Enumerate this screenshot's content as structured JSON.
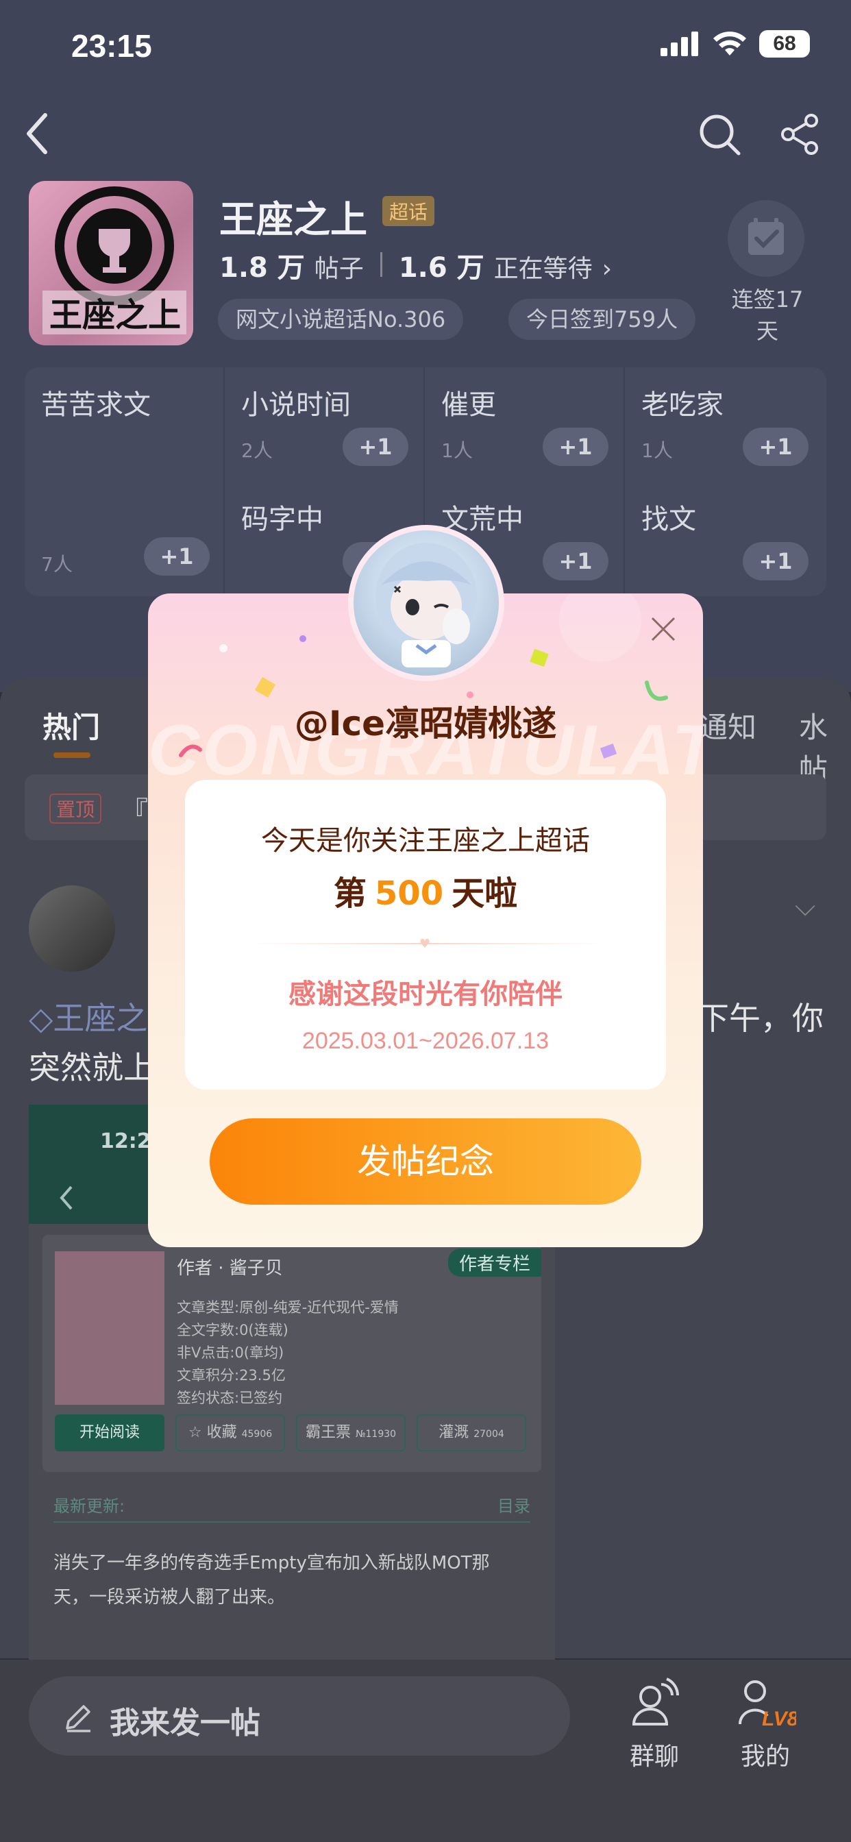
{
  "status_bar": {
    "time": "23:15",
    "battery": "68"
  },
  "topic": {
    "title": "王座之上",
    "badge": "超话",
    "posts_count": "1.8 万",
    "posts_label": "帖子",
    "waiting_count": "1.6 万",
    "waiting_label": "正在等待",
    "rank_tag": "网文小说超话No.306",
    "checkin_tag": "今日签到759人",
    "streak_line1": "连签17",
    "streak_line2": "天"
  },
  "groups": [
    {
      "name": "苦苦求文",
      "count": "7人",
      "plus": "+1"
    },
    {
      "name": "小说时间",
      "count": "2人",
      "plus": "+1"
    },
    {
      "name": "催更",
      "count": "1人",
      "plus": "+1"
    },
    {
      "name": "老吃家",
      "count": "1人",
      "plus": "+1"
    },
    {
      "name": "码字中",
      "count": "",
      "plus": "+1"
    },
    {
      "name": "文荒中",
      "count": "",
      "plus": "+1"
    },
    {
      "name": "找文",
      "count": "",
      "plus": "+1"
    }
  ],
  "tabs": {
    "hot": "热门",
    "notice": "通知",
    "water": "水帖"
  },
  "pinned": {
    "badge": "置顶",
    "text": "『超"
  },
  "post": {
    "topic_link": "王座之",
    "text_line1_end": "下午，你",
    "text_line2": "突然就上"
  },
  "book": {
    "time": "12:27",
    "author": "作者 · 酱子贝",
    "column_btn": "作者专栏",
    "meta": [
      "文章类型:原创-纯爱-近代现代-爱情",
      "全文字数:0(连载)",
      "非V点击:0(章均)",
      "文章积分:23.5亿",
      "签约状态:已签约"
    ],
    "read_btn": "开始阅读",
    "collect": "收藏",
    "collect_num": "45906",
    "bawang": "霸王票",
    "bawang_num": "№11930",
    "irrigate": "灌溉",
    "irrigate_num": "27004",
    "latest": "最新更新:",
    "toc": "目录",
    "excerpt": "消失了一年多的传奇选手Empty宣布加入新战队MOT那天，一段采访被人翻了出来。"
  },
  "bottom_bar": {
    "compose": "我来发一帖",
    "group_chat": "群聊",
    "mine": "我的",
    "level": "LV8"
  },
  "modal": {
    "bg_word": "CONGRATULATE",
    "username": "@Ice凛昭婧桃遂",
    "line1": "今天是你关注王座之上超话",
    "line2_prefix": "第",
    "days": "500",
    "line2_suffix": "天啦",
    "thanks": "感谢这段时光有你陪伴",
    "date_range": "2025.03.01~2026.07.13",
    "button": "发帖纪念"
  },
  "colors": {
    "accent_orange": "#f5910d",
    "button_start": "#fb8509",
    "button_end": "#fdb636",
    "brown_text": "#5a2108",
    "pink_text": "#f07a78"
  }
}
